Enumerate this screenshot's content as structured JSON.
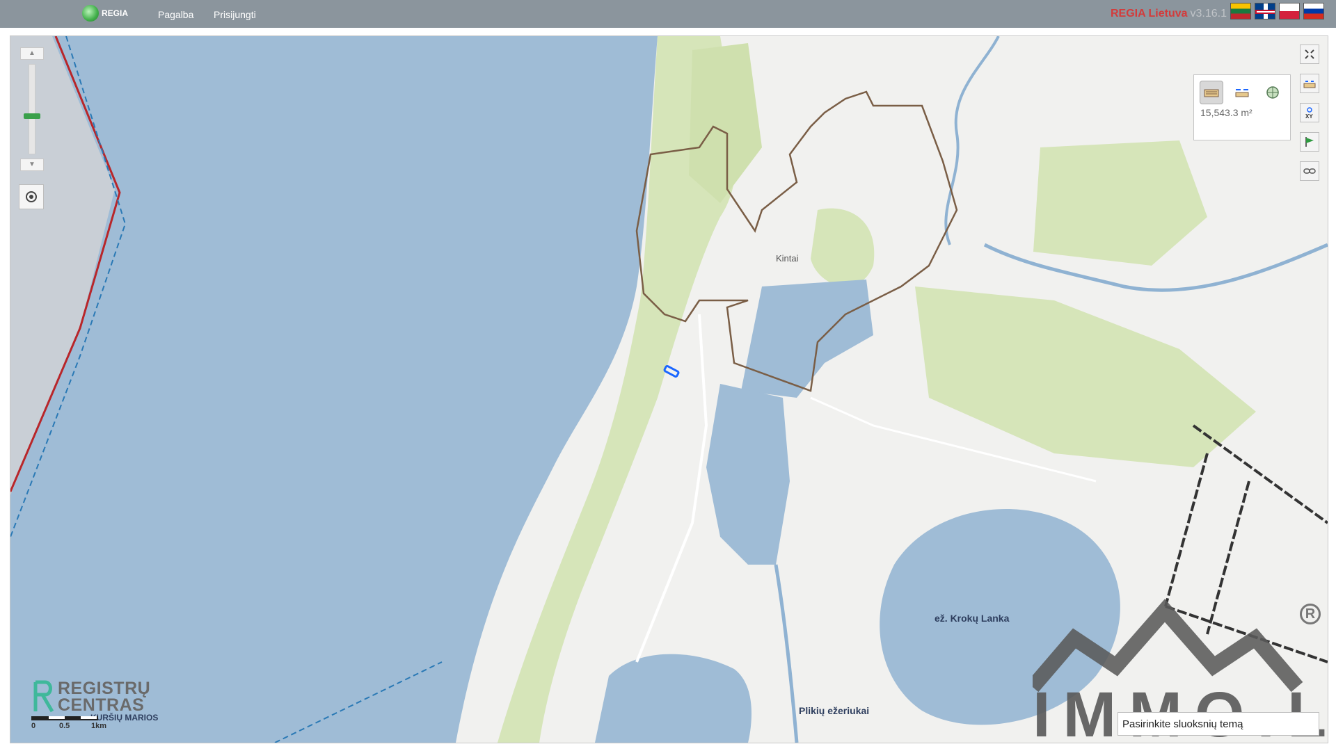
{
  "header": {
    "logo_text": "REGIA",
    "nav": [
      {
        "label": "Pagalba"
      },
      {
        "label": "Prisijungti"
      }
    ],
    "app_name": "REGIA Lietuva",
    "version": "v3.16.1",
    "languages": [
      {
        "name": "lt-flag-icon"
      },
      {
        "name": "en-flag-icon"
      },
      {
        "name": "pl-flag-icon"
      },
      {
        "name": "ru-flag-icon"
      }
    ]
  },
  "map": {
    "labels": {
      "town": "Kintai",
      "lake": "ež. Krokų Lanka",
      "lake2": "Plikių ežeriukai",
      "lagoon": "KURŠIŲ MARIOS"
    },
    "measurement": {
      "value": "15,543.3 m²",
      "tools": [
        "area-measure-icon",
        "distance-measure-icon",
        "globe-icon"
      ]
    },
    "toolbar": [
      "fullscreen-icon",
      "measure-ruler-icon",
      "xy-coordinates-icon",
      "flag-marker-icon",
      "link-icon"
    ],
    "zoom": {
      "level_fraction": 0.58
    },
    "scale": {
      "labels": [
        "0",
        "0.5",
        "1km"
      ]
    },
    "logo": {
      "line1": "REGISTRŲ",
      "line2": "CENTRAS"
    },
    "watermark": {
      "text": "IMMO.LT"
    },
    "search": {
      "value": "Pasirinkite sluoksnių temą"
    },
    "colors": {
      "water": "#9fbcd6",
      "forest": "#d6e5b9",
      "land": "#f1f1ef",
      "boundary": "#7a5e46",
      "border_red": "#b8262a",
      "border_blue": "#2a79b5",
      "selection": "#1a66ff"
    }
  }
}
